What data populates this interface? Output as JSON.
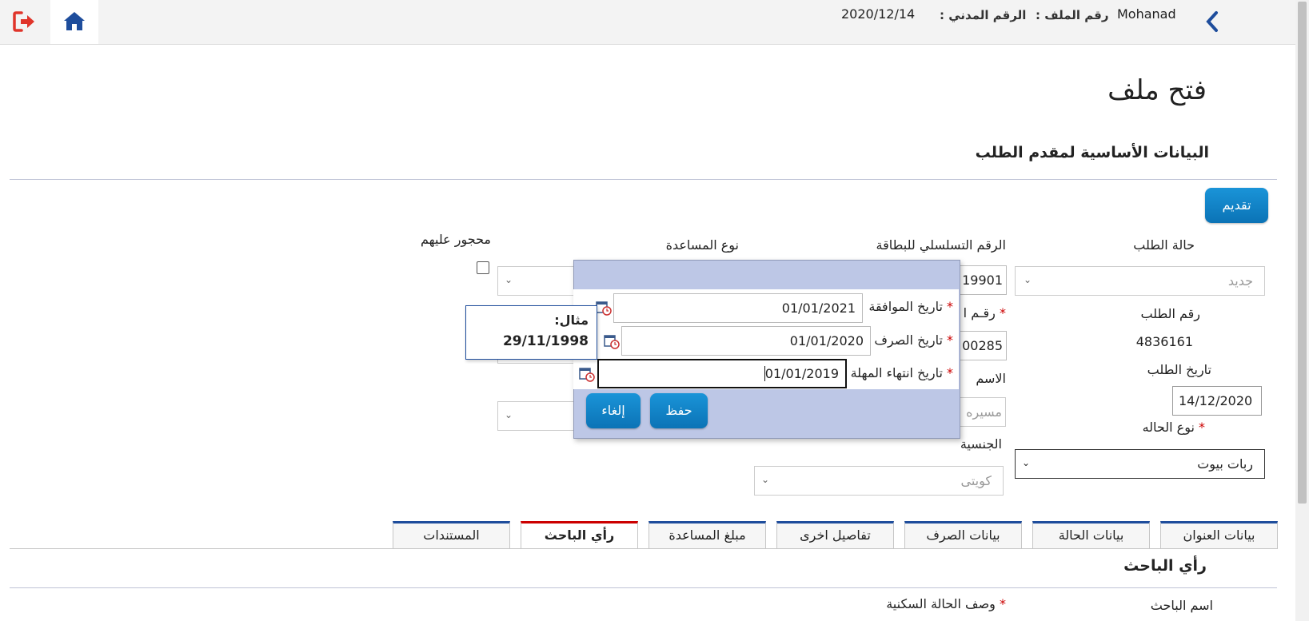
{
  "header": {
    "username": "Mohanad",
    "file_number_label": "رقم الملف :",
    "civil_id_label": "الرقم المدني :",
    "date": "2020/12/14"
  },
  "page": {
    "title": "فتح ملف"
  },
  "section_basic": {
    "title": "البيانات الأساسية لمقدم الطلب"
  },
  "submit_button": "تقديم",
  "form": {
    "request_status": {
      "label": "حالة الطلب",
      "value": "جديد"
    },
    "card_serial": {
      "label": "الرقم التسلسلي للبطاقة",
      "value": "19901"
    },
    "assistance_type": {
      "label": "نوع المساعدة"
    },
    "restricted": {
      "label": "محجور عليهم"
    },
    "request_number": {
      "label": "رقم الطلب",
      "value": "4836161"
    },
    "partial_label": "رقـم ا",
    "partial_value": "00285",
    "request_date": {
      "label": "تاريخ الطلب",
      "value": "14/12/2020"
    },
    "name": {
      "label": "الاسم",
      "value": "مسيره"
    },
    "case_type": {
      "label": "نوع الحاله",
      "value": "ربات بيوت"
    },
    "nationality": {
      "label": "الجنسية",
      "value": "كويتى"
    }
  },
  "popup": {
    "approval_date": {
      "label": "تاريخ الموافقة",
      "value": "01/01/2021"
    },
    "payment_date": {
      "label": "تاريخ الصرف",
      "value": "01/01/2020"
    },
    "deadline_date": {
      "label": "تاريخ انتهاء المهلة",
      "value": "01/01/2019"
    },
    "save": "حفظ",
    "cancel": "إلغاء"
  },
  "tooltip": {
    "title": "مثال:",
    "example": "29/11/1998"
  },
  "tabs": [
    {
      "label": "بيانات العنوان"
    },
    {
      "label": "بيانات الحالة"
    },
    {
      "label": "بيانات الصرف"
    },
    {
      "label": "تفاصيل اخرى"
    },
    {
      "label": "مبلغ المساعدة"
    },
    {
      "label": "رأي الباحث"
    },
    {
      "label": "المستندات"
    }
  ],
  "researcher_section": {
    "title": "رأي الباحث",
    "researcher_name_label": "اسم الباحث",
    "housing_desc_label": "وصف الحالة السكنية"
  },
  "colors": {
    "primary": "#0b73b6",
    "nav": "#1e4d9c",
    "required": "#cc0000",
    "logout": "#e0342a"
  }
}
